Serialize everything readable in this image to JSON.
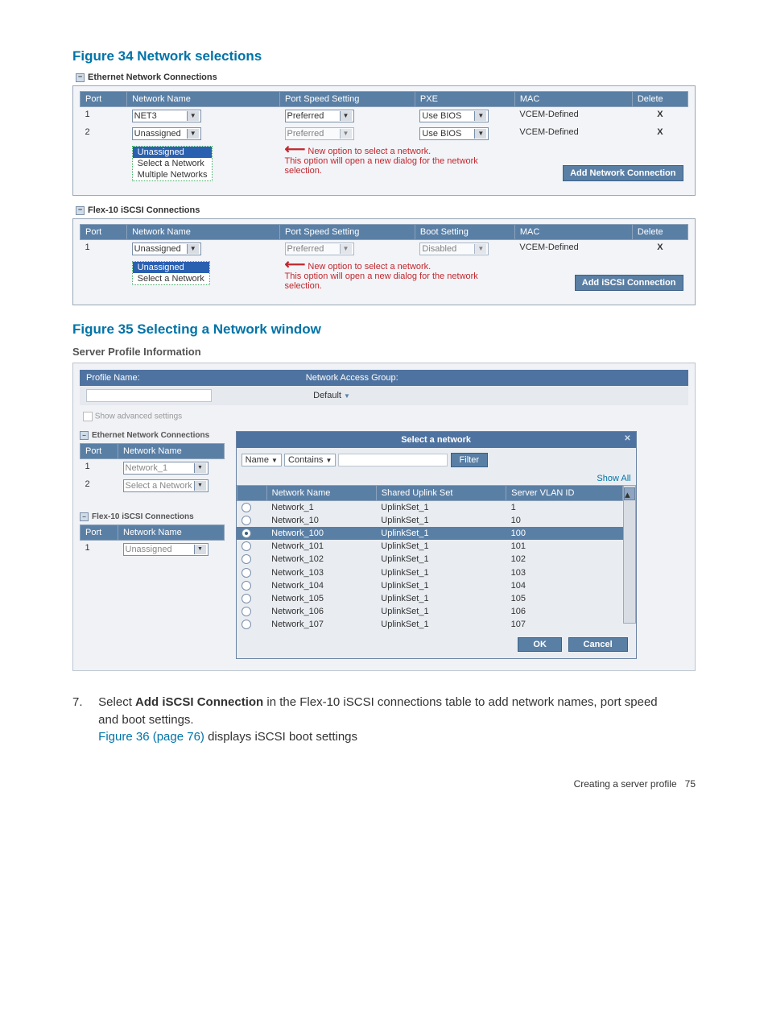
{
  "fig34": {
    "title": "Figure 34 Network selections",
    "eth_label": "Ethernet Network Connections",
    "iscsi_label": "Flex-10 iSCSI Connections",
    "headers": {
      "port": "Port",
      "net": "Network Name",
      "pss": "Port Speed Setting",
      "pxe": "PXE",
      "boot": "Boot Setting",
      "mac": "MAC",
      "del": "Delete"
    },
    "eth_rows": [
      {
        "port": "1",
        "net": "NET3",
        "pss": "Preferred",
        "pxe": "Use BIOS",
        "mac": "VCEM-Defined",
        "del": "X"
      },
      {
        "port": "2",
        "net": "Unassigned",
        "pss": "Preferred",
        "pxe": "Use BIOS",
        "mac": "VCEM-Defined",
        "del": "X"
      }
    ],
    "eth_dropdown": [
      "Unassigned",
      "Select a Network",
      "Multiple Networks"
    ],
    "iscsi_rows": [
      {
        "port": "1",
        "net": "Unassigned",
        "pss": "Preferred",
        "boot": "Disabled",
        "mac": "VCEM-Defined",
        "del": "X"
      }
    ],
    "iscsi_dropdown": [
      "Unassigned",
      "Select a Network"
    ],
    "note1": "New option to select a network.",
    "note2": "This option will open a new dialog for the network selection.",
    "add_net_btn": "Add Network Connection",
    "add_iscsi_btn": "Add iSCSI Connection"
  },
  "fig35": {
    "title": "Figure 35 Selecting a Network window",
    "spi": "Server Profile Information",
    "profile_name_lbl": "Profile Name:",
    "nag_lbl": "Network Access Group:",
    "nag_val": "Default",
    "show_adv": "Show advanced settings",
    "eth_label": "Ethernet Network Connections",
    "iscsi_label": "Flex-10 iSCSI Connections",
    "left_headers": {
      "port": "Port",
      "net": "Network Name"
    },
    "left_eth_rows": [
      {
        "port": "1",
        "net": "Network_1"
      },
      {
        "port": "2",
        "net": "Select a Network"
      }
    ],
    "left_iscsi_rows": [
      {
        "port": "1",
        "net": "Unassigned"
      }
    ],
    "dialog": {
      "title": "Select a network",
      "filter_field": "Name",
      "filter_op": "Contains",
      "filter_btn": "Filter",
      "show_all": "Show All",
      "headers": {
        "net": "Network Name",
        "uplink": "Shared Uplink Set",
        "vlan": "Server VLAN ID"
      },
      "rows": [
        {
          "net": "Network_1",
          "uplink": "UplinkSet_1",
          "vlan": "1",
          "sel": false
        },
        {
          "net": "Network_10",
          "uplink": "UplinkSet_1",
          "vlan": "10",
          "sel": false
        },
        {
          "net": "Network_100",
          "uplink": "UplinkSet_1",
          "vlan": "100",
          "sel": true
        },
        {
          "net": "Network_101",
          "uplink": "UplinkSet_1",
          "vlan": "101",
          "sel": false
        },
        {
          "net": "Network_102",
          "uplink": "UplinkSet_1",
          "vlan": "102",
          "sel": false
        },
        {
          "net": "Network_103",
          "uplink": "UplinkSet_1",
          "vlan": "103",
          "sel": false
        },
        {
          "net": "Network_104",
          "uplink": "UplinkSet_1",
          "vlan": "104",
          "sel": false
        },
        {
          "net": "Network_105",
          "uplink": "UplinkSet_1",
          "vlan": "105",
          "sel": false
        },
        {
          "net": "Network_106",
          "uplink": "UplinkSet_1",
          "vlan": "106",
          "sel": false
        },
        {
          "net": "Network_107",
          "uplink": "UplinkSet_1",
          "vlan": "107",
          "sel": false
        }
      ],
      "ok": "OK",
      "cancel": "Cancel"
    }
  },
  "step7": {
    "num": "7.",
    "text_a": "Select ",
    "bold": "Add iSCSI Connection",
    "text_b": " in the Flex-10 iSCSI connections table to add network names, port speed and boot settings.",
    "link": "Figure 36 (page 76)",
    "text_c": " displays iSCSI boot settings"
  },
  "footer": {
    "label": "Creating a server profile",
    "page": "75"
  }
}
